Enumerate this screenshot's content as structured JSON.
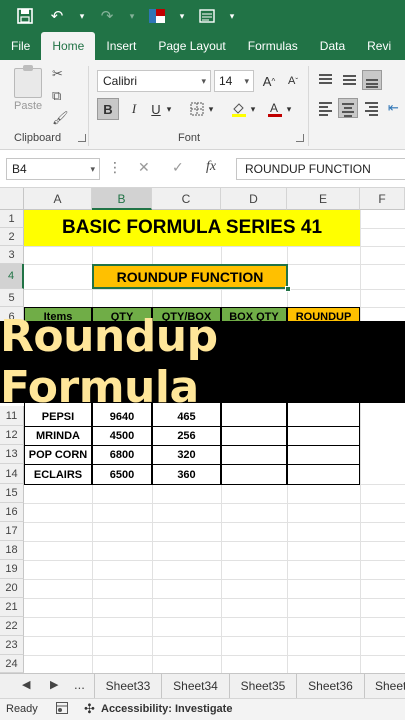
{
  "ribbon": {
    "tabs": [
      "File",
      "Home",
      "Insert",
      "Page Layout",
      "Formulas",
      "Data",
      "Revi"
    ],
    "active_tab": "Home",
    "clipboard": {
      "label": "Clipboard",
      "paste_label": "Paste"
    },
    "font": {
      "label": "Font",
      "family": "Calibri",
      "size": "14",
      "bold": "B",
      "italic": "I",
      "underline": "U"
    }
  },
  "formula_bar": {
    "name_box": "B4",
    "content": "ROUNDUP FUNCTION",
    "fx": "fx"
  },
  "grid": {
    "columns": [
      "A",
      "B",
      "C",
      "D",
      "E",
      "F"
    ],
    "selected_column": "B",
    "rows": [
      "1",
      "2",
      "3",
      "4",
      "5",
      "6",
      "11",
      "12",
      "13",
      "14",
      "15",
      "16",
      "17",
      "18",
      "19",
      "20",
      "21",
      "22",
      "23",
      "24"
    ],
    "selected_row": "4",
    "title": "BASIC FORMULA SERIES 41",
    "subtitle": "ROUNDUP FUNCTION",
    "table_headers": [
      "Items",
      "QTY",
      "QTY/BOX",
      "BOX QTY",
      "ROUNDUP"
    ],
    "table_rows": [
      {
        "item": "PEPSI",
        "qty": "9640",
        "qty_box": "465"
      },
      {
        "item": "MRINDA",
        "qty": "4500",
        "qty_box": "256"
      },
      {
        "item": "POP CORN",
        "qty": "6800",
        "qty_box": "320"
      },
      {
        "item": "ECLAIRS",
        "qty": "6500",
        "qty_box": "360"
      }
    ]
  },
  "banner": {
    "text": "Roundup Formula"
  },
  "sheets": {
    "tabs": [
      "Sheet33",
      "Sheet34",
      "Sheet35",
      "Sheet36",
      "Sheet"
    ],
    "more": "..."
  },
  "status": {
    "ready": "Ready",
    "accessibility": "Accessibility: Investigate"
  },
  "colors": {
    "excel_green": "#217346",
    "title_fill": "#ffff00",
    "subtitle_fill": "#ffc000",
    "header_green": "#70ad47",
    "banner_text": "#ffe699"
  }
}
